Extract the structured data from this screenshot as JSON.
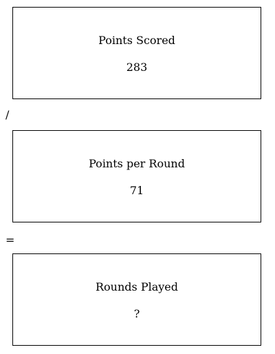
{
  "boxes": [
    {
      "label": "Points Scored",
      "value": "283"
    },
    {
      "label": "Points per Round",
      "value": "71"
    },
    {
      "label": "Rounds Played",
      "value": "?"
    }
  ],
  "operators": [
    "/",
    "="
  ]
}
